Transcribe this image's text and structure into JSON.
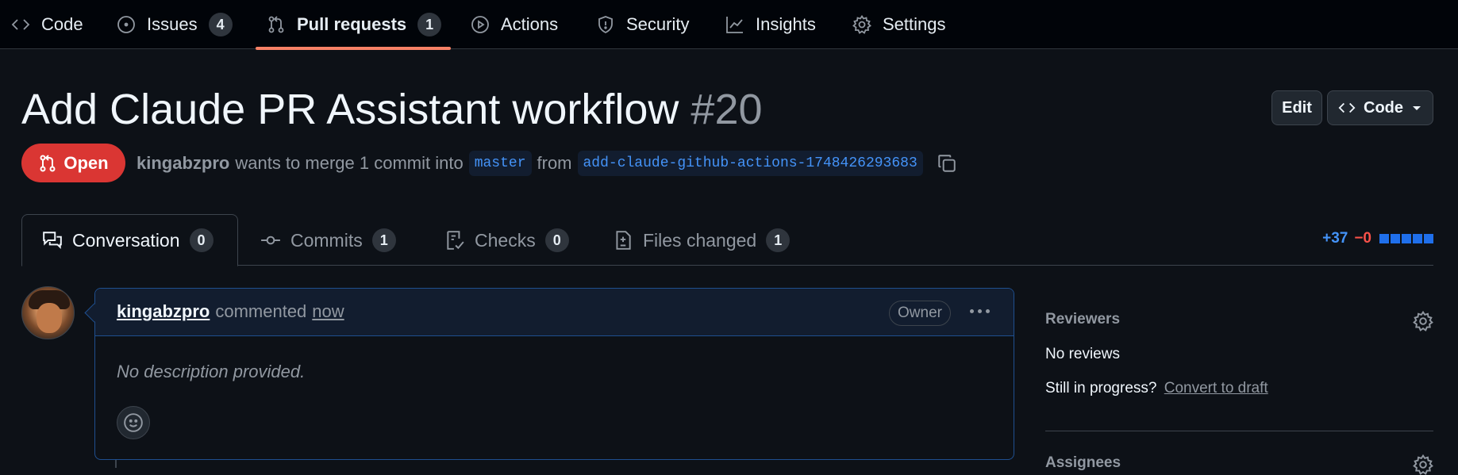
{
  "repo_nav": {
    "tabs": [
      {
        "label": "Code",
        "icon": "code-icon"
      },
      {
        "label": "Issues",
        "icon": "issue-icon",
        "count": "4"
      },
      {
        "label": "Pull requests",
        "icon": "pull-request-icon",
        "count": "1",
        "selected": true
      },
      {
        "label": "Actions",
        "icon": "play-icon"
      },
      {
        "label": "Security",
        "icon": "shield-icon"
      },
      {
        "label": "Insights",
        "icon": "graph-icon"
      },
      {
        "label": "Settings",
        "icon": "gear-icon"
      }
    ]
  },
  "pr": {
    "title": "Add Claude PR Assistant workflow",
    "number": "#20",
    "state": "Open",
    "author": "kingabzpro",
    "merge_text": "wants to merge 1 commit into",
    "base_branch": "master",
    "from_text": "from",
    "head_branch": "add-claude-github-actions-1748426293683"
  },
  "header_buttons": {
    "edit": "Edit",
    "code": "Code"
  },
  "pr_tabs": [
    {
      "label": "Conversation",
      "count": "0",
      "icon": "comment-discussion-icon",
      "selected": true
    },
    {
      "label": "Commits",
      "count": "1",
      "icon": "commit-icon"
    },
    {
      "label": "Checks",
      "count": "0",
      "icon": "checklist-icon"
    },
    {
      "label": "Files changed",
      "count": "1",
      "icon": "file-diff-icon"
    }
  ],
  "diffstat": {
    "additions": "+37",
    "deletions": "−0",
    "colors": {
      "add": "#4493f8",
      "del": "#f85149"
    }
  },
  "comment": {
    "author": "kingabzpro",
    "action": "commented",
    "time": "now",
    "role": "Owner",
    "body": "No description provided."
  },
  "sidebar": {
    "reviewers_heading": "Reviewers",
    "reviewers_value": "No reviews",
    "progress_text": "Still in progress?",
    "convert_link": "Convert to draft",
    "assignees_heading": "Assignees"
  }
}
